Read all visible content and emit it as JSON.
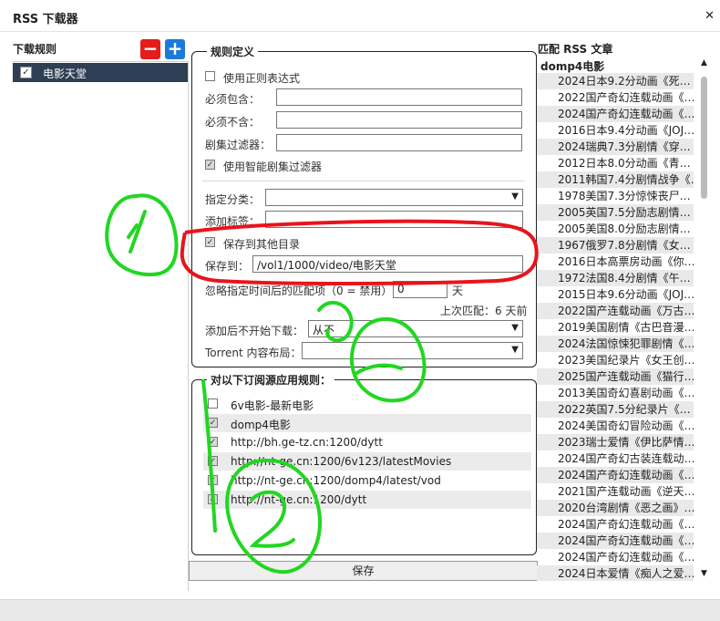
{
  "window": {
    "title": "RSS 下载器"
  },
  "left": {
    "header": "下载规则",
    "remove_label": "−",
    "add_label": "+",
    "rules": [
      {
        "label": "电影天堂",
        "checked": true
      }
    ]
  },
  "rule_def": {
    "legend": "规则定义",
    "use_regex_label": "使用正则表达式",
    "must_contain_label": "必须包含：",
    "must_not_contain_label": "必须不含：",
    "episode_filter_label": "剧集过滤器：",
    "smart_filter_label": "使用智能剧集过滤器",
    "category_label": "指定分类：",
    "tags_label": "添加标签：",
    "save_other_dir_label": "保存到其他目录",
    "save_to_label": "保存到：",
    "save_path": "/vol1/1000/video/电影天堂",
    "ignore_label": "忽略指定时间后的匹配项（0 = 禁用）",
    "ignore_value": "0",
    "ignore_unit": "天",
    "last_match": "上次匹配：6 天前",
    "add_paused_label": "添加后不开始下载：",
    "add_paused_value": "从不",
    "torrent_layout_label": "Torrent 内容布局："
  },
  "feeds": {
    "legend": "对以下订阅源应用规则：",
    "items": [
      {
        "label": "6v电影-最新电影",
        "checked": false
      },
      {
        "label": "domp4电影",
        "checked": true
      },
      {
        "label": "http://bh.ge-tz.cn:1200/dytt",
        "checked": true
      },
      {
        "label": "http://nt-ge.cn:1200/6v123/latestMovies",
        "checked": true
      },
      {
        "label": "http://nt-ge.cn:1200/domp4/latest/vod",
        "checked": true
      },
      {
        "label": "http://nt-ge.cn:1200/dytt",
        "checked": true
      }
    ]
  },
  "save_button": "保存",
  "right": {
    "header": "匹配 RSS 文章",
    "feed_name": "domp4电影",
    "articles": [
      "2024日本9.2分动画《死…",
      "2022国产奇幻连载动画《…",
      "2024国产奇幻连载动画《…",
      "2016日本9.4分动画《JOJ…",
      "2024瑞典7.3分剧情《穿…",
      "2012日本8.0分动画《青…",
      "2011韩国7.4分剧情战争《…",
      "1978美国7.3分惊悚丧尸…",
      "2005英国7.5分励志剧情…",
      "2005美国8.0分励志剧情…",
      "1967俄罗7.8分剧情《女…",
      "2016日本高票房动画《你…",
      "1972法国8.4分剧情《午…",
      "2015日本9.6分动画《JOJ…",
      "2022国产连载动画《万古…",
      "2019美国剧情《古巴音漫…",
      "2024法国惊悚犯罪剧情《…",
      "2023美国纪录片《女王创…",
      "2025国产连载动画《猫行…",
      "2013美国奇幻喜剧动画《…",
      "2022英国7.5分纪录片《…",
      "2024美国奇幻冒险动画《…",
      "2023瑞士爱情《伊比萨情…",
      "2024国产奇幻古装连载动…",
      "2024国产奇幻连载动画《…",
      "2021国产连载动画《逆天…",
      "2020台湾剧情《恶之画》…",
      "2024国产奇幻连载动画《…",
      "2024国产奇幻连载动画《…",
      "2024国产奇幻连载动画《…",
      "2024日本爱情《痴人之爱…"
    ]
  },
  "annotations": {
    "circle_1": "1",
    "circle_2": "2",
    "circle_3": "3",
    "color": "#22d622",
    "highlight_color": "#e8141c"
  }
}
